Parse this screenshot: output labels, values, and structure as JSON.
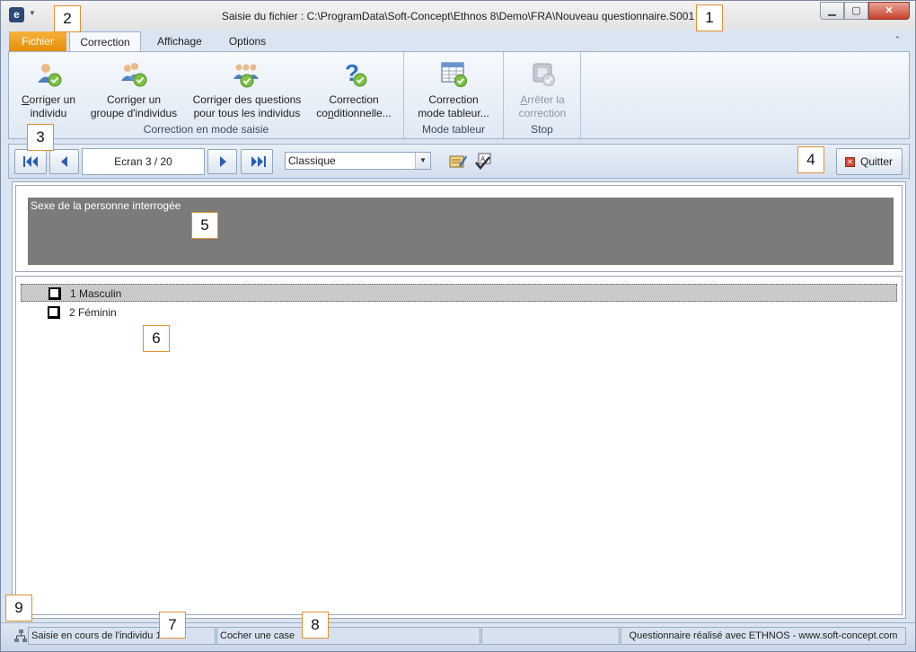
{
  "window": {
    "title": "Saisie du fichier : C:\\ProgramData\\Soft-Concept\\Ethnos 8\\Demo\\FRA\\Nouveau questionnaire.S001",
    "app_icon_letter": "e"
  },
  "tabs": [
    "Fichier",
    "Correction",
    "Affichage",
    "Options"
  ],
  "ribbon": {
    "groups": [
      {
        "label": "Correction en mode saisie",
        "buttons": [
          {
            "line1": "Corriger un",
            "line2": "individu",
            "accel": "C",
            "line1_rest": "orriger un"
          },
          {
            "line1": "Corriger un",
            "line2": "groupe d'individus"
          },
          {
            "line1": "Corriger des questions",
            "line2": "pour tous les individus"
          },
          {
            "line1": "Correction",
            "line2_pre": "co",
            "line2_accel": "n",
            "line2_rest": "ditionnelle..."
          }
        ]
      },
      {
        "label": "Mode tableur",
        "buttons": [
          {
            "line1": "Correction",
            "line2": "mode tableur..."
          }
        ]
      },
      {
        "label": "Stop",
        "buttons": [
          {
            "line1_accel": "A",
            "line1_rest": "rrêter la",
            "line2": "correction"
          }
        ]
      }
    ]
  },
  "nav": {
    "screen": "Ecran 3 / 20",
    "mode": "Classique",
    "quit": "Quitter"
  },
  "question": {
    "text": "Sexe de la personne interrogée"
  },
  "answers": [
    {
      "label": "1  Masculin",
      "selected": true
    },
    {
      "label": "2  Féminin",
      "selected": false
    }
  ],
  "status": {
    "individual": "Saisie en cours de l'individu 1",
    "hint": "Cocher une case",
    "empty": "",
    "credit": "Questionnaire réalisé avec ETHNOS - www.soft-concept.com"
  },
  "callouts": [
    "1",
    "2",
    "3",
    "4",
    "5",
    "6",
    "7",
    "8",
    "9"
  ],
  "colors": {
    "fichier_tab": "#e58d0a",
    "question_bg": "#7b7b7b",
    "callout_border": "#e09030",
    "check_badge": "#7cc242"
  }
}
